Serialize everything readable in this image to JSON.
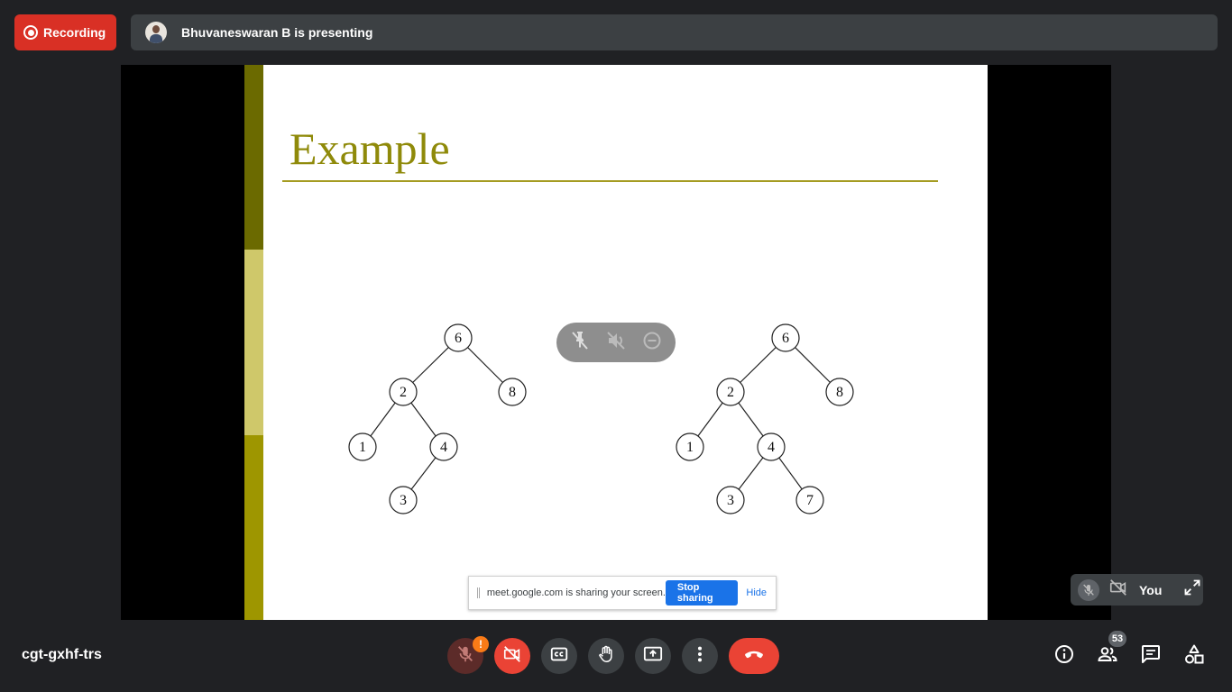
{
  "recording": {
    "label": "Recording",
    "color": "#d93025"
  },
  "presenter": {
    "text": "Bhuvaneswaran B is presenting"
  },
  "slide": {
    "title": "Example",
    "tree_left": {
      "nodes": [
        "6",
        "2",
        "8",
        "1",
        "4",
        "3"
      ]
    },
    "tree_right": {
      "nodes": [
        "6",
        "2",
        "8",
        "1",
        "4",
        "3",
        "7"
      ]
    }
  },
  "floating_controls": {
    "icons": [
      "unpin-icon",
      "mute-audio-icon",
      "remove-icon"
    ]
  },
  "share_notice": {
    "text": "meet.google.com is sharing your screen.",
    "stop_label": "Stop sharing",
    "hide_label": "Hide"
  },
  "self_view": {
    "name": "You"
  },
  "meeting": {
    "code": "cgt-gxhf-trs"
  },
  "controls": {
    "mic_alert": "!",
    "icons": [
      "mic-off-icon",
      "camera-off-icon",
      "captions-icon",
      "raise-hand-icon",
      "present-icon",
      "more-options-icon",
      "end-call-icon"
    ]
  },
  "side": {
    "participants_count": "53"
  },
  "colors": {
    "accent": "#1a73e8",
    "danger": "#ea4335",
    "bg": "#202124",
    "title": "#8f8a0a"
  }
}
